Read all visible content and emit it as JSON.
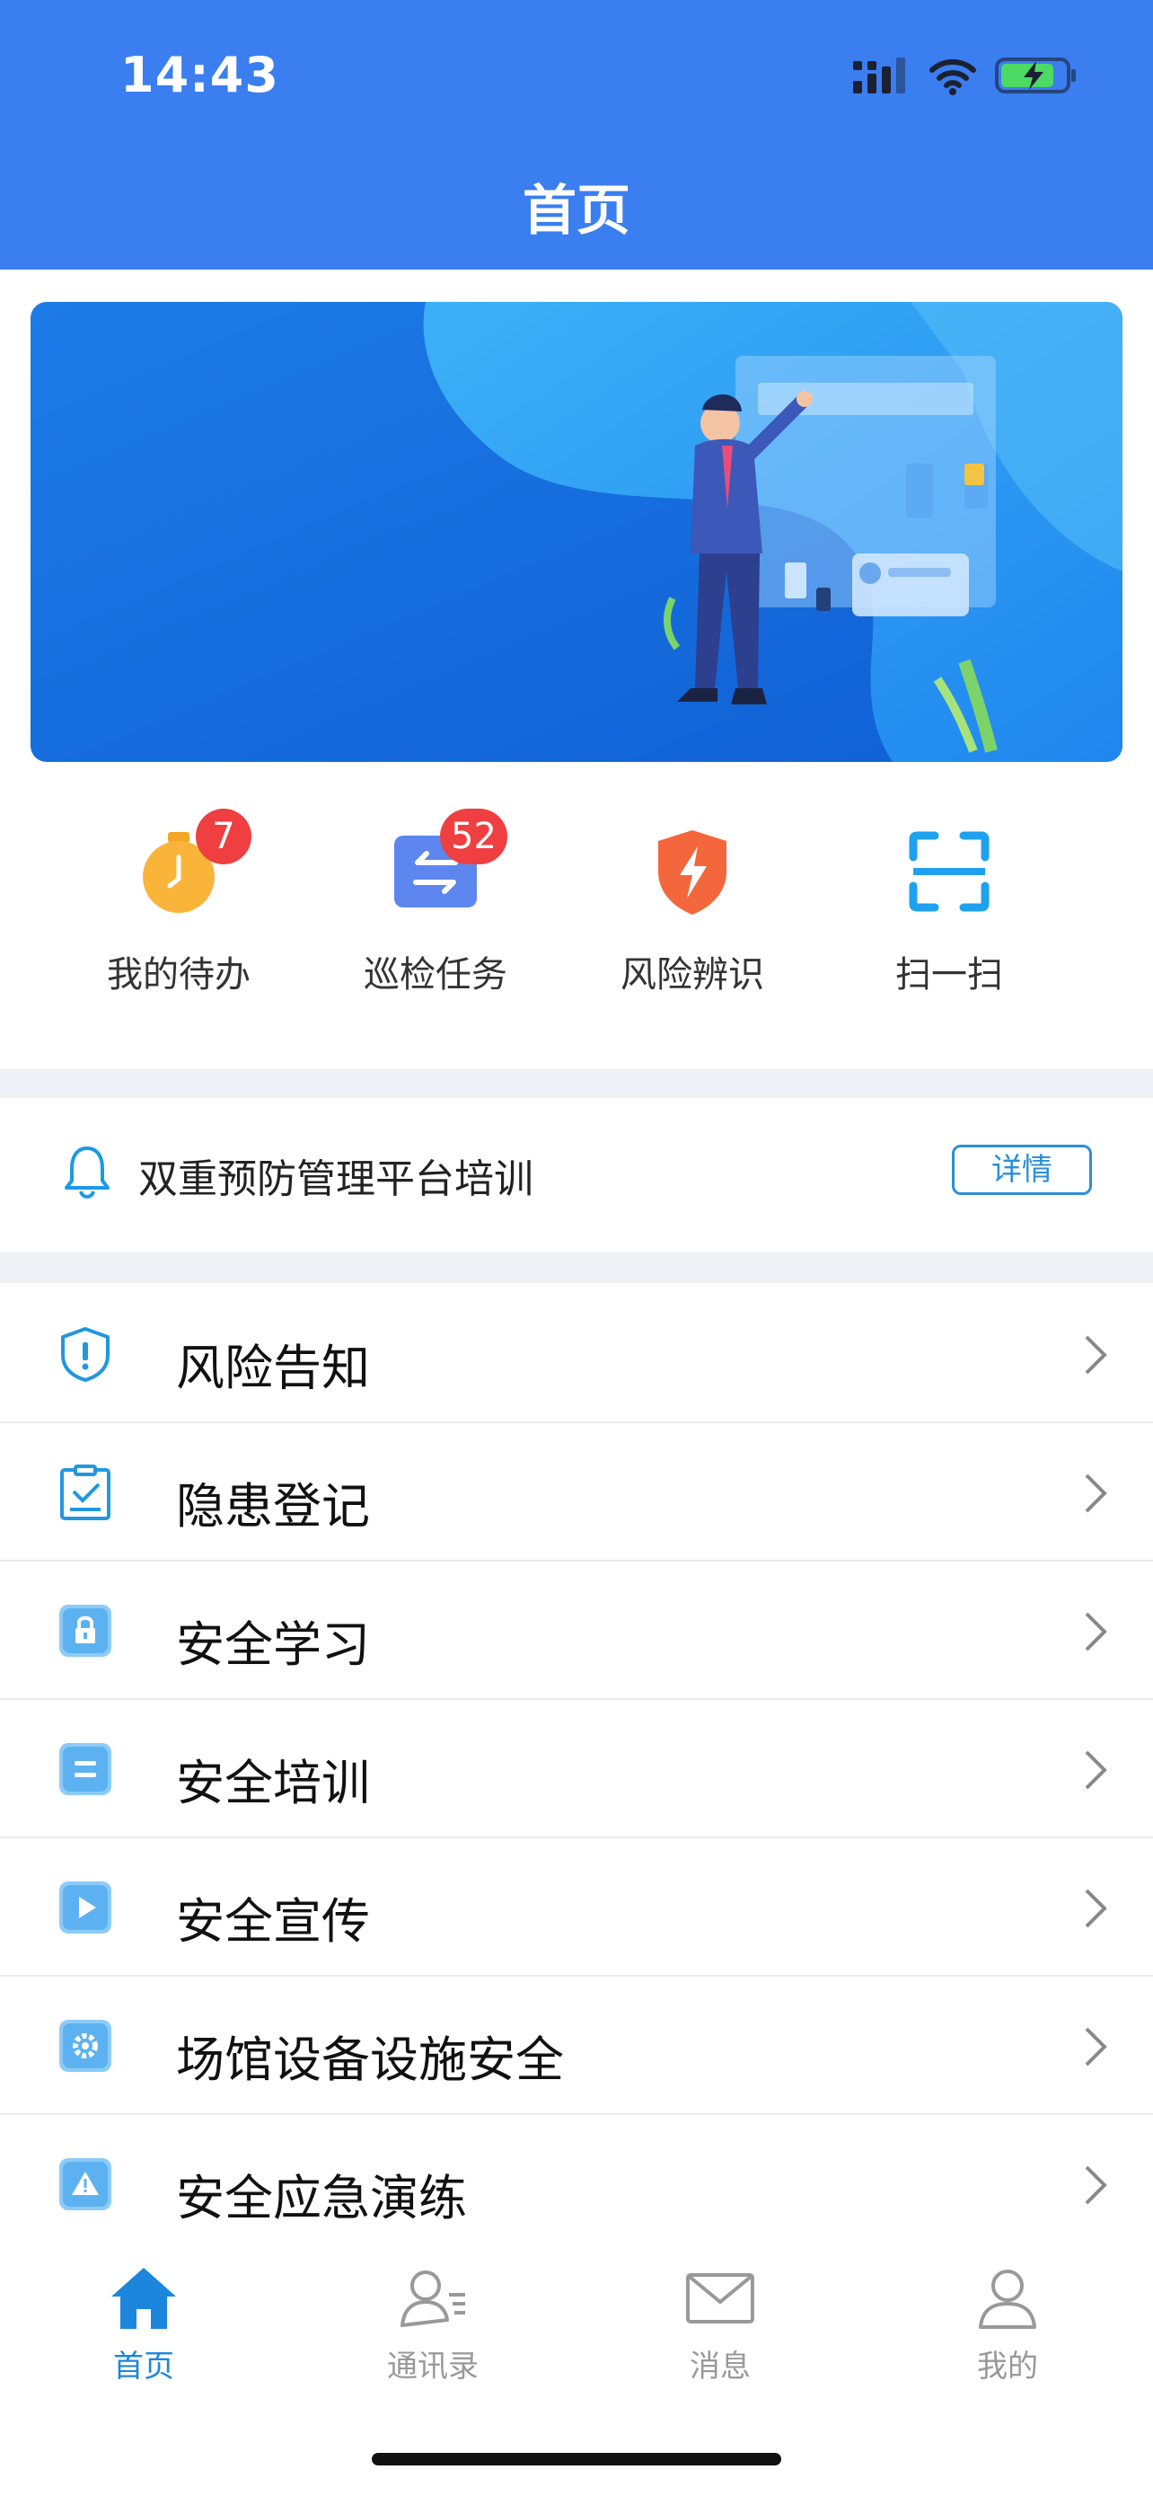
{
  "status_bar": {
    "time": "14:43"
  },
  "header": {
    "title": "首页"
  },
  "quick_actions": [
    {
      "label": "我的待办",
      "badge": "7",
      "icon": "timer-icon"
    },
    {
      "label": "巡检任务",
      "badge": "52",
      "icon": "swap-arrows-icon"
    },
    {
      "label": "风险辨识",
      "badge": "",
      "icon": "lightning-shield-icon"
    },
    {
      "label": "扫一扫",
      "badge": "",
      "icon": "scan-icon"
    }
  ],
  "notice": {
    "text": "双重预防管理平台培训",
    "button": "详情"
  },
  "menu": [
    {
      "label": "风险告知",
      "icon": "shield-exclamation-icon"
    },
    {
      "label": "隐患登记",
      "icon": "clipboard-check-icon"
    },
    {
      "label": "安全学习",
      "icon": "lock-icon"
    },
    {
      "label": "安全培训",
      "icon": "list-icon"
    },
    {
      "label": "安全宣传",
      "icon": "play-icon"
    },
    {
      "label": "场馆设备设施安全",
      "icon": "gear-icon"
    },
    {
      "label": "安全应急演练",
      "icon": "warning-icon"
    }
  ],
  "tabbar": [
    {
      "label": "首页",
      "active": true,
      "icon": "home-icon"
    },
    {
      "label": "通讯录",
      "active": false,
      "icon": "contacts-icon"
    },
    {
      "label": "消息",
      "active": false,
      "icon": "mail-icon"
    },
    {
      "label": "我的",
      "active": false,
      "icon": "person-icon"
    }
  ],
  "colors": {
    "primary": "#3a7ef0",
    "badge": "#ef3f40",
    "accent": "#1b86dc"
  }
}
